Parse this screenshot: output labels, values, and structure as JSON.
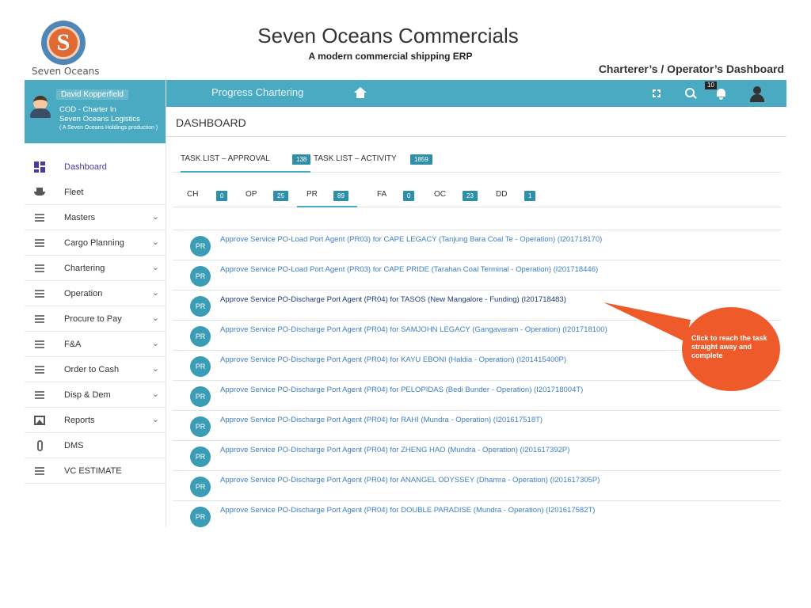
{
  "brand": {
    "logo_text": "Seven Oceans",
    "logo_letter": "S",
    "title": "Seven Oceans Commercials",
    "subtitle": "A modern commercial shipping ERP",
    "caption": "Charterer’s  / Operator’s Dashboard",
    "accent_color": "#4aaac2",
    "callout_color": "#ef5a2a"
  },
  "user": {
    "name": "David Kopperfield",
    "role": "COD - Charter In",
    "org": "Seven Oceans Logistics",
    "tag": "( A Seven Oceans Holdings production )"
  },
  "topbar": {
    "title": "Progress Chartering",
    "notification_count": "10",
    "icons": [
      "home-icon",
      "expand-icon",
      "search-icon",
      "bell-icon",
      "user-icon"
    ]
  },
  "sidebar": {
    "items": [
      {
        "label": "Dashboard",
        "icon": "dashboard-grid-icon",
        "active": true
      },
      {
        "label": "Fleet",
        "icon": "ship-icon"
      },
      {
        "label": "Masters",
        "icon": "list-icon",
        "expandable": true
      },
      {
        "label": "Cargo Planning",
        "icon": "list-icon",
        "expandable": true
      },
      {
        "label": "Chartering",
        "icon": "list-icon",
        "expandable": true
      },
      {
        "label": "Operation",
        "icon": "list-icon",
        "expandable": true
      },
      {
        "label": "Procure to Pay",
        "icon": "list-icon",
        "expandable": true
      },
      {
        "label": "F&A",
        "icon": "list-icon",
        "expandable": true
      },
      {
        "label": "Order to Cash",
        "icon": "list-icon",
        "expandable": true
      },
      {
        "label": "Disp & Dem",
        "icon": "list-icon",
        "expandable": true
      },
      {
        "label": "Reports",
        "icon": "reports-icon",
        "expandable": true
      },
      {
        "label": "DMS",
        "icon": "paperclip-icon"
      },
      {
        "label": "VC ESTIMATE",
        "icon": "list-icon"
      }
    ]
  },
  "main": {
    "title": "DASHBOARD",
    "task_tabs": [
      {
        "label": "TASK LIST – APPROVAL",
        "count": "138",
        "active": true
      },
      {
        "label": "TASK LIST – ACTIVITY",
        "count": "1859"
      }
    ],
    "sub_tabs": [
      {
        "label": "CH",
        "count": "0"
      },
      {
        "label": "OP",
        "count": "25"
      },
      {
        "label": "PR",
        "count": "89",
        "active": true
      },
      {
        "label": "FA",
        "count": "0"
      },
      {
        "label": "OC",
        "count": "23"
      },
      {
        "label": "DD",
        "count": "1"
      }
    ],
    "tasks": [
      {
        "badge": "PR",
        "text": "Approve Service PO-Load Port Agent (PR03) for CAPE LEGACY (Tanjung Bara Coal Te - Operation) (I201718170)"
      },
      {
        "badge": "PR",
        "text": "Approve Service PO-Load Port Agent (PR03) for CAPE PRIDE (Tarahan Coal Terminal - Operation) (I201718446)"
      },
      {
        "badge": "PR",
        "text": "Approve Service PO-Discharge Port Agent (PR04) for TASOS (New Mangalore - Funding) (I201718483)",
        "highlight": true
      },
      {
        "badge": "PR",
        "text": "Approve Service PO-Discharge Port Agent (PR04) for SAMJOHN LEGACY (Gangavaram - Operation) (I201718100)"
      },
      {
        "badge": "PR",
        "text": "Approve Service PO-Discharge Port Agent (PR04) for KAYU EBONI (Haldia - Operation) (I201415400P)"
      },
      {
        "badge": "PR",
        "text": "Approve Service PO-Discharge Port Agent (PR04) for PELOPIDAS (Bedi Bunder - Operation) (I201718004T)"
      },
      {
        "badge": "PR",
        "text": "Approve Service PO-Discharge Port Agent (PR04) for RAHI (Mundra - Operation) (I201617518T)"
      },
      {
        "badge": "PR",
        "text": "Approve Service PO-Discharge Port Agent (PR04) for ZHENG HAO (Mundra - Operation) (I201617392P)"
      },
      {
        "badge": "PR",
        "text": "Approve Service PO-Discharge Port Agent (PR04) for ANANGEL ODYSSEY (Dhamra - Operation) (I201617305P)"
      },
      {
        "badge": "PR",
        "text": "Approve Service PO-Discharge Port Agent (PR04) for DOUBLE PARADISE (Mundra - Operation) (I201617582T)"
      }
    ]
  },
  "callout": {
    "text": "Click to reach the task straight away and complete"
  }
}
